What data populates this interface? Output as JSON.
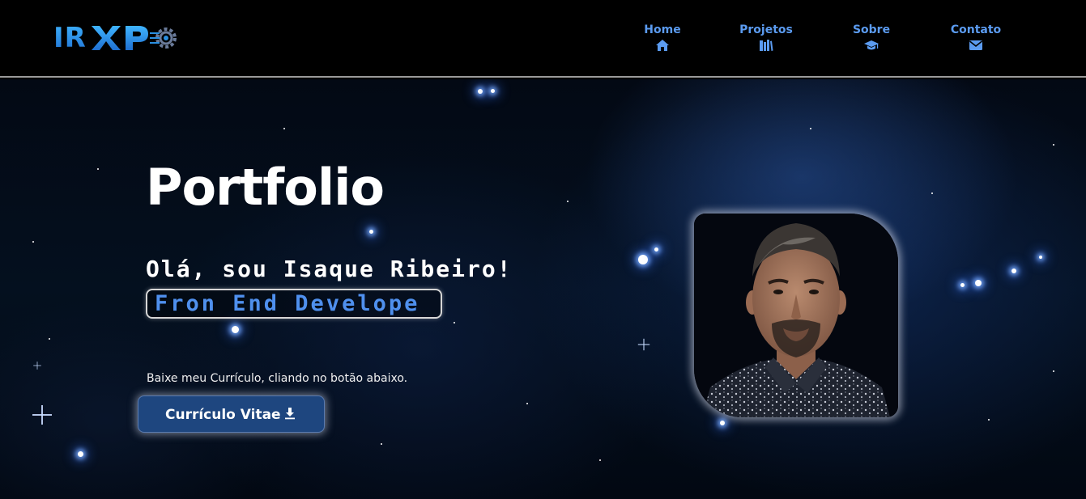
{
  "logo": {
    "text": "IR",
    "name": "IRXP logo"
  },
  "nav": {
    "items": [
      {
        "label": "Home",
        "icon": "home-icon"
      },
      {
        "label": "Projetos",
        "icon": "books-icon"
      },
      {
        "label": "Sobre",
        "icon": "graduation-cap-icon"
      },
      {
        "label": "Contato",
        "icon": "envelope-icon"
      }
    ]
  },
  "hero": {
    "title": "Portfolio",
    "greeting": "Olá, sou Isaque Ribeiro!",
    "role": "Fron End Develope",
    "cv_hint": "Baixe meu Currículo, cliando no botão abaixo.",
    "cv_button_label": "Currículo Vitae",
    "cv_button_icon": "download-icon"
  },
  "profile": {
    "photo": "profile-photo"
  },
  "colors": {
    "accent": "#5b9bf0",
    "role_text": "#4f90ee",
    "button_bg": "#1e467f",
    "logo_blue": "#2a8fe0",
    "header_bg": "#000000"
  }
}
